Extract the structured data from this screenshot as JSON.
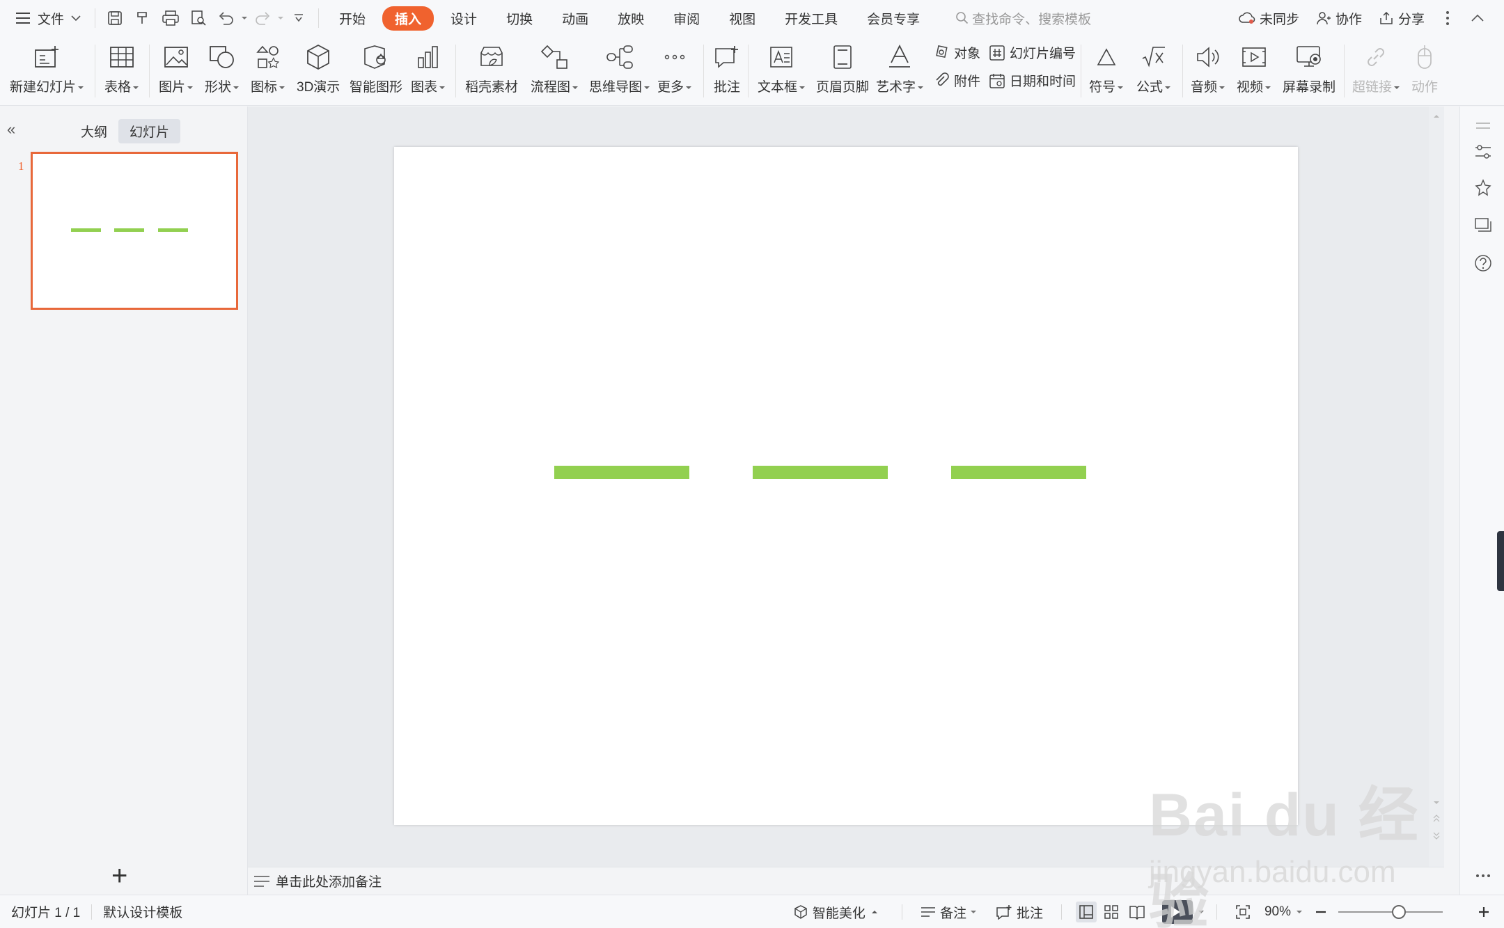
{
  "menubar": {
    "file_label": "文件",
    "tabs": [
      {
        "label": "开始",
        "active": false
      },
      {
        "label": "插入",
        "active": true
      },
      {
        "label": "设计",
        "active": false
      },
      {
        "label": "切换",
        "active": false
      },
      {
        "label": "动画",
        "active": false
      },
      {
        "label": "放映",
        "active": false
      },
      {
        "label": "审阅",
        "active": false
      },
      {
        "label": "视图",
        "active": false
      },
      {
        "label": "开发工具",
        "active": false
      },
      {
        "label": "会员专享",
        "active": false
      }
    ],
    "search_placeholder": "查找命令、搜索模板",
    "sync_label": "未同步",
    "collab_label": "协作",
    "share_label": "分享"
  },
  "ribbon": {
    "new_slide": "新建幻灯片",
    "table": "表格",
    "picture": "图片",
    "shape": "形状",
    "icon": "图标",
    "demo3d": "3D演示",
    "smartart": "智能图形",
    "chart": "图表",
    "material": "稻壳素材",
    "flowchart": "流程图",
    "mindmap": "思维导图",
    "more": "更多",
    "comment": "批注",
    "textbox": "文本框",
    "header_footer": "页眉页脚",
    "wordart": "艺术字",
    "object": "对象",
    "attachment": "附件",
    "slide_number": "幻灯片编号",
    "datetime": "日期和时间",
    "symbol": "符号",
    "formula": "公式",
    "audio": "音频",
    "video": "视频",
    "screen_record": "屏幕录制",
    "hyperlink": "超链接",
    "action": "动作"
  },
  "leftpanel": {
    "tab_outline": "大纲",
    "tab_slides": "幻灯片",
    "slide_number": "1"
  },
  "slide": {
    "bar_color": "#92d050"
  },
  "notes": {
    "placeholder": "单击此处添加备注"
  },
  "statusbar": {
    "slide_info": "幻灯片 1 / 1",
    "template": "默认设计模板",
    "beautify": "智能美化",
    "notes": "备注",
    "comments": "批注",
    "zoom": "90%",
    "zoom_level": 0.58
  },
  "watermark": {
    "brand": "Bai du 经验",
    "url": "jingyan.baidu.com"
  },
  "colors": {
    "accent": "#f0622e",
    "thumb_border": "#e8683a"
  }
}
